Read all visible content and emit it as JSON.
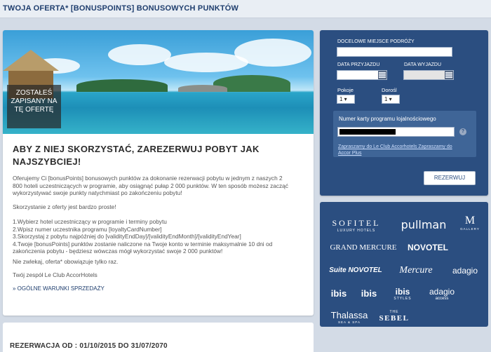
{
  "header": {
    "title": "Twoja oferta* [bonusPoints] bonusowych punktów"
  },
  "hero": {
    "badge_line1": "Zostałeś",
    "badge_line2": "zapisany na",
    "badge_line3": "tę ofertę"
  },
  "main": {
    "heading_line1": "Aby z niej skorzystać, zarezerwuj pobyt jak",
    "heading_line2": "najszybciej!",
    "p1_line1": "Oferujemy Ci [bonusPoints] bonusowych punktów za dokonanie rezerwacji pobytu w jednym z naszych 2",
    "p1_line2": "800 hoteli uczestniczących w programie, aby osiągnąć pułap 2 000 punktów. W ten sposób możesz zacząć",
    "p1_line3": "wykorzystywać swoje punkty natychmiast po zakończeniu pobytu!",
    "p2": "Skorzystanie z oferty jest bardzo proste!",
    "steps": [
      "1.Wybierz hotel uczestniczący w programie i terminy pobytu",
      "2.Wpisz numer uczestnika programu [loyaltyCardNumber]",
      "3.Skorzystaj z pobytu najpóźniej do [validityEndDay]/[validityEndMonth]/[validityEndYear]",
      "4.Twoje [bonusPoints] punktów zostanie naliczone na Twoje konto w terminie maksymalnie 10 dni od",
      "zakończenia pobytu - będziesz wówczas mógł wykorzystać swoje 2 000 punktów!"
    ],
    "p3": "Nie zwlekaj, oferta* obowiązuje tylko raz.",
    "signature": "Twój zespół Le Club AccorHotels",
    "terms_link": "» Ogólne warunki sprzedaży"
  },
  "bottom": {
    "text": "Rezerwacja od : 01/10/2015 do 31/07/2070"
  },
  "booking": {
    "destination_label": "Docelowe miejsce podróży",
    "destination_value": "",
    "arrival_label": "Data przyjazdu",
    "departure_label": "Data wyjazdu",
    "rooms_label": "Pokoje",
    "rooms_value": "1 ▾",
    "children_label": "Dorośl",
    "children_value": "1 ▾",
    "loyalty_label": "Numer karty programu lojalnościowego",
    "help": "?",
    "link1": "Zapraszamy do Le Club Accorhotels",
    "link2": "Zapraszamy do",
    "link3": "Accor Plus",
    "book_button": "Rezerwuj"
  },
  "brands": {
    "sofitel": "SOFITEL",
    "sofitel_sub": "LUXURY HOTELS",
    "pullman": "pullman",
    "mgallery": "M",
    "mgallery_sub": "GALLERY",
    "grand_mercure": "GRAND MERCURE",
    "novotel": "NOVOTEL",
    "suite_novotel": "Suite NOVOTEL",
    "mercure": "Mercure",
    "adagio": "adagio",
    "ibis": "ibis",
    "ibis2": "ibis",
    "ibis_styles": "ibis",
    "ibis_styles_sub": "STYLES",
    "adagio_access": "adagio",
    "adagio_access_sub": "access",
    "thalassa": "Thalassa",
    "thalassa_sub": "SEA & SPA",
    "sebel": "SEBEL",
    "sebel_pre": "THE"
  }
}
